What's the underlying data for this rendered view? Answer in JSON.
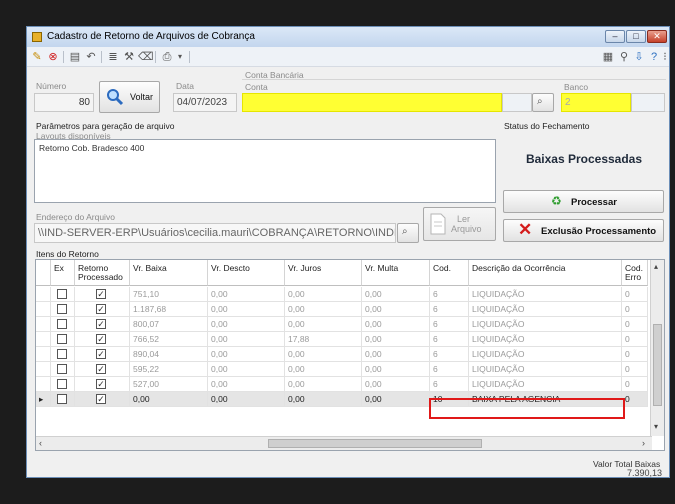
{
  "window": {
    "title": "Cadastro de Retorno de Arquivos de Cobrança"
  },
  "titlebar_buttons": {
    "minimize": "–",
    "maximize": "□",
    "close": "✕"
  },
  "header": {
    "numero_label": "Número",
    "numero_value": "80",
    "voltar_label": "Voltar",
    "data_label": "Data",
    "data_value": "04/07/2023",
    "conta_bancaria_label": "Conta Bancária",
    "conta_label": "Conta",
    "conta_value": "",
    "banco_label": "Banco",
    "banco_value": "2"
  },
  "params": {
    "group_label": "Parâmetros para geração de arquivo",
    "layouts_label": "Layouts disponíveis",
    "layout_item": "Retorno Cob. Bradesco 400"
  },
  "status": {
    "group_label": "Status do Fechamento",
    "value": "Baixas Processadas"
  },
  "actions": {
    "processar_label": "Processar",
    "exclusao_label": "Exclusão Processamento"
  },
  "endereco": {
    "label": "Endereço do Arquivo",
    "value": "\\\\IND-SERVER-ERP\\Usuários\\cecilia.mauri\\COBRANÇA\\RETORNO\\INDIRA\\",
    "ler_label_1": "Ler",
    "ler_label_2": "Arquivo"
  },
  "grid": {
    "label": "Itens do Retorno",
    "columns": [
      "Ex",
      "Retorno Processado",
      "Vr. Baixa",
      "Vr. Descto",
      "Vr. Juros",
      "Vr. Multa",
      "Cod.",
      "Descrição da Ocorrência",
      "Cod. Erro"
    ],
    "rows": [
      {
        "vr_baixa": "751,10",
        "vr_descto": "0,00",
        "vr_juros": "0,00",
        "vr_multa": "0,00",
        "cod": "6",
        "descricao": "LIQUIDAÇÃO",
        "cod_erro": "0"
      },
      {
        "vr_baixa": "1.187,68",
        "vr_descto": "0,00",
        "vr_juros": "0,00",
        "vr_multa": "0,00",
        "cod": "6",
        "descricao": "LIQUIDAÇÃO",
        "cod_erro": "0"
      },
      {
        "vr_baixa": "800,07",
        "vr_descto": "0,00",
        "vr_juros": "0,00",
        "vr_multa": "0,00",
        "cod": "6",
        "descricao": "LIQUIDAÇÃO",
        "cod_erro": "0"
      },
      {
        "vr_baixa": "766,52",
        "vr_descto": "0,00",
        "vr_juros": "17,88",
        "vr_multa": "0,00",
        "cod": "6",
        "descricao": "LIQUIDAÇÃO",
        "cod_erro": "0"
      },
      {
        "vr_baixa": "890,04",
        "vr_descto": "0,00",
        "vr_juros": "0,00",
        "vr_multa": "0,00",
        "cod": "6",
        "descricao": "LIQUIDAÇÃO",
        "cod_erro": "0"
      },
      {
        "vr_baixa": "595,22",
        "vr_descto": "0,00",
        "vr_juros": "0,00",
        "vr_multa": "0,00",
        "cod": "6",
        "descricao": "LIQUIDAÇÃO",
        "cod_erro": "0"
      },
      {
        "vr_baixa": "527,00",
        "vr_descto": "0,00",
        "vr_juros": "0,00",
        "vr_multa": "0,00",
        "cod": "6",
        "descricao": "LIQUIDAÇÃO",
        "cod_erro": "0"
      },
      {
        "vr_baixa": "0,00",
        "vr_descto": "0,00",
        "vr_juros": "0,00",
        "vr_multa": "0,00",
        "cod": "10",
        "descricao": "BAIXA PELA AGENCIA",
        "cod_erro": "0"
      }
    ]
  },
  "footer": {
    "valor_total_label": "Valor Total Baixas",
    "valor_total_value": "7.390,13"
  },
  "colors": {
    "highlight": "#ffff33",
    "red_box": "#e01919",
    "title_gradient": "#c3d6ee"
  }
}
